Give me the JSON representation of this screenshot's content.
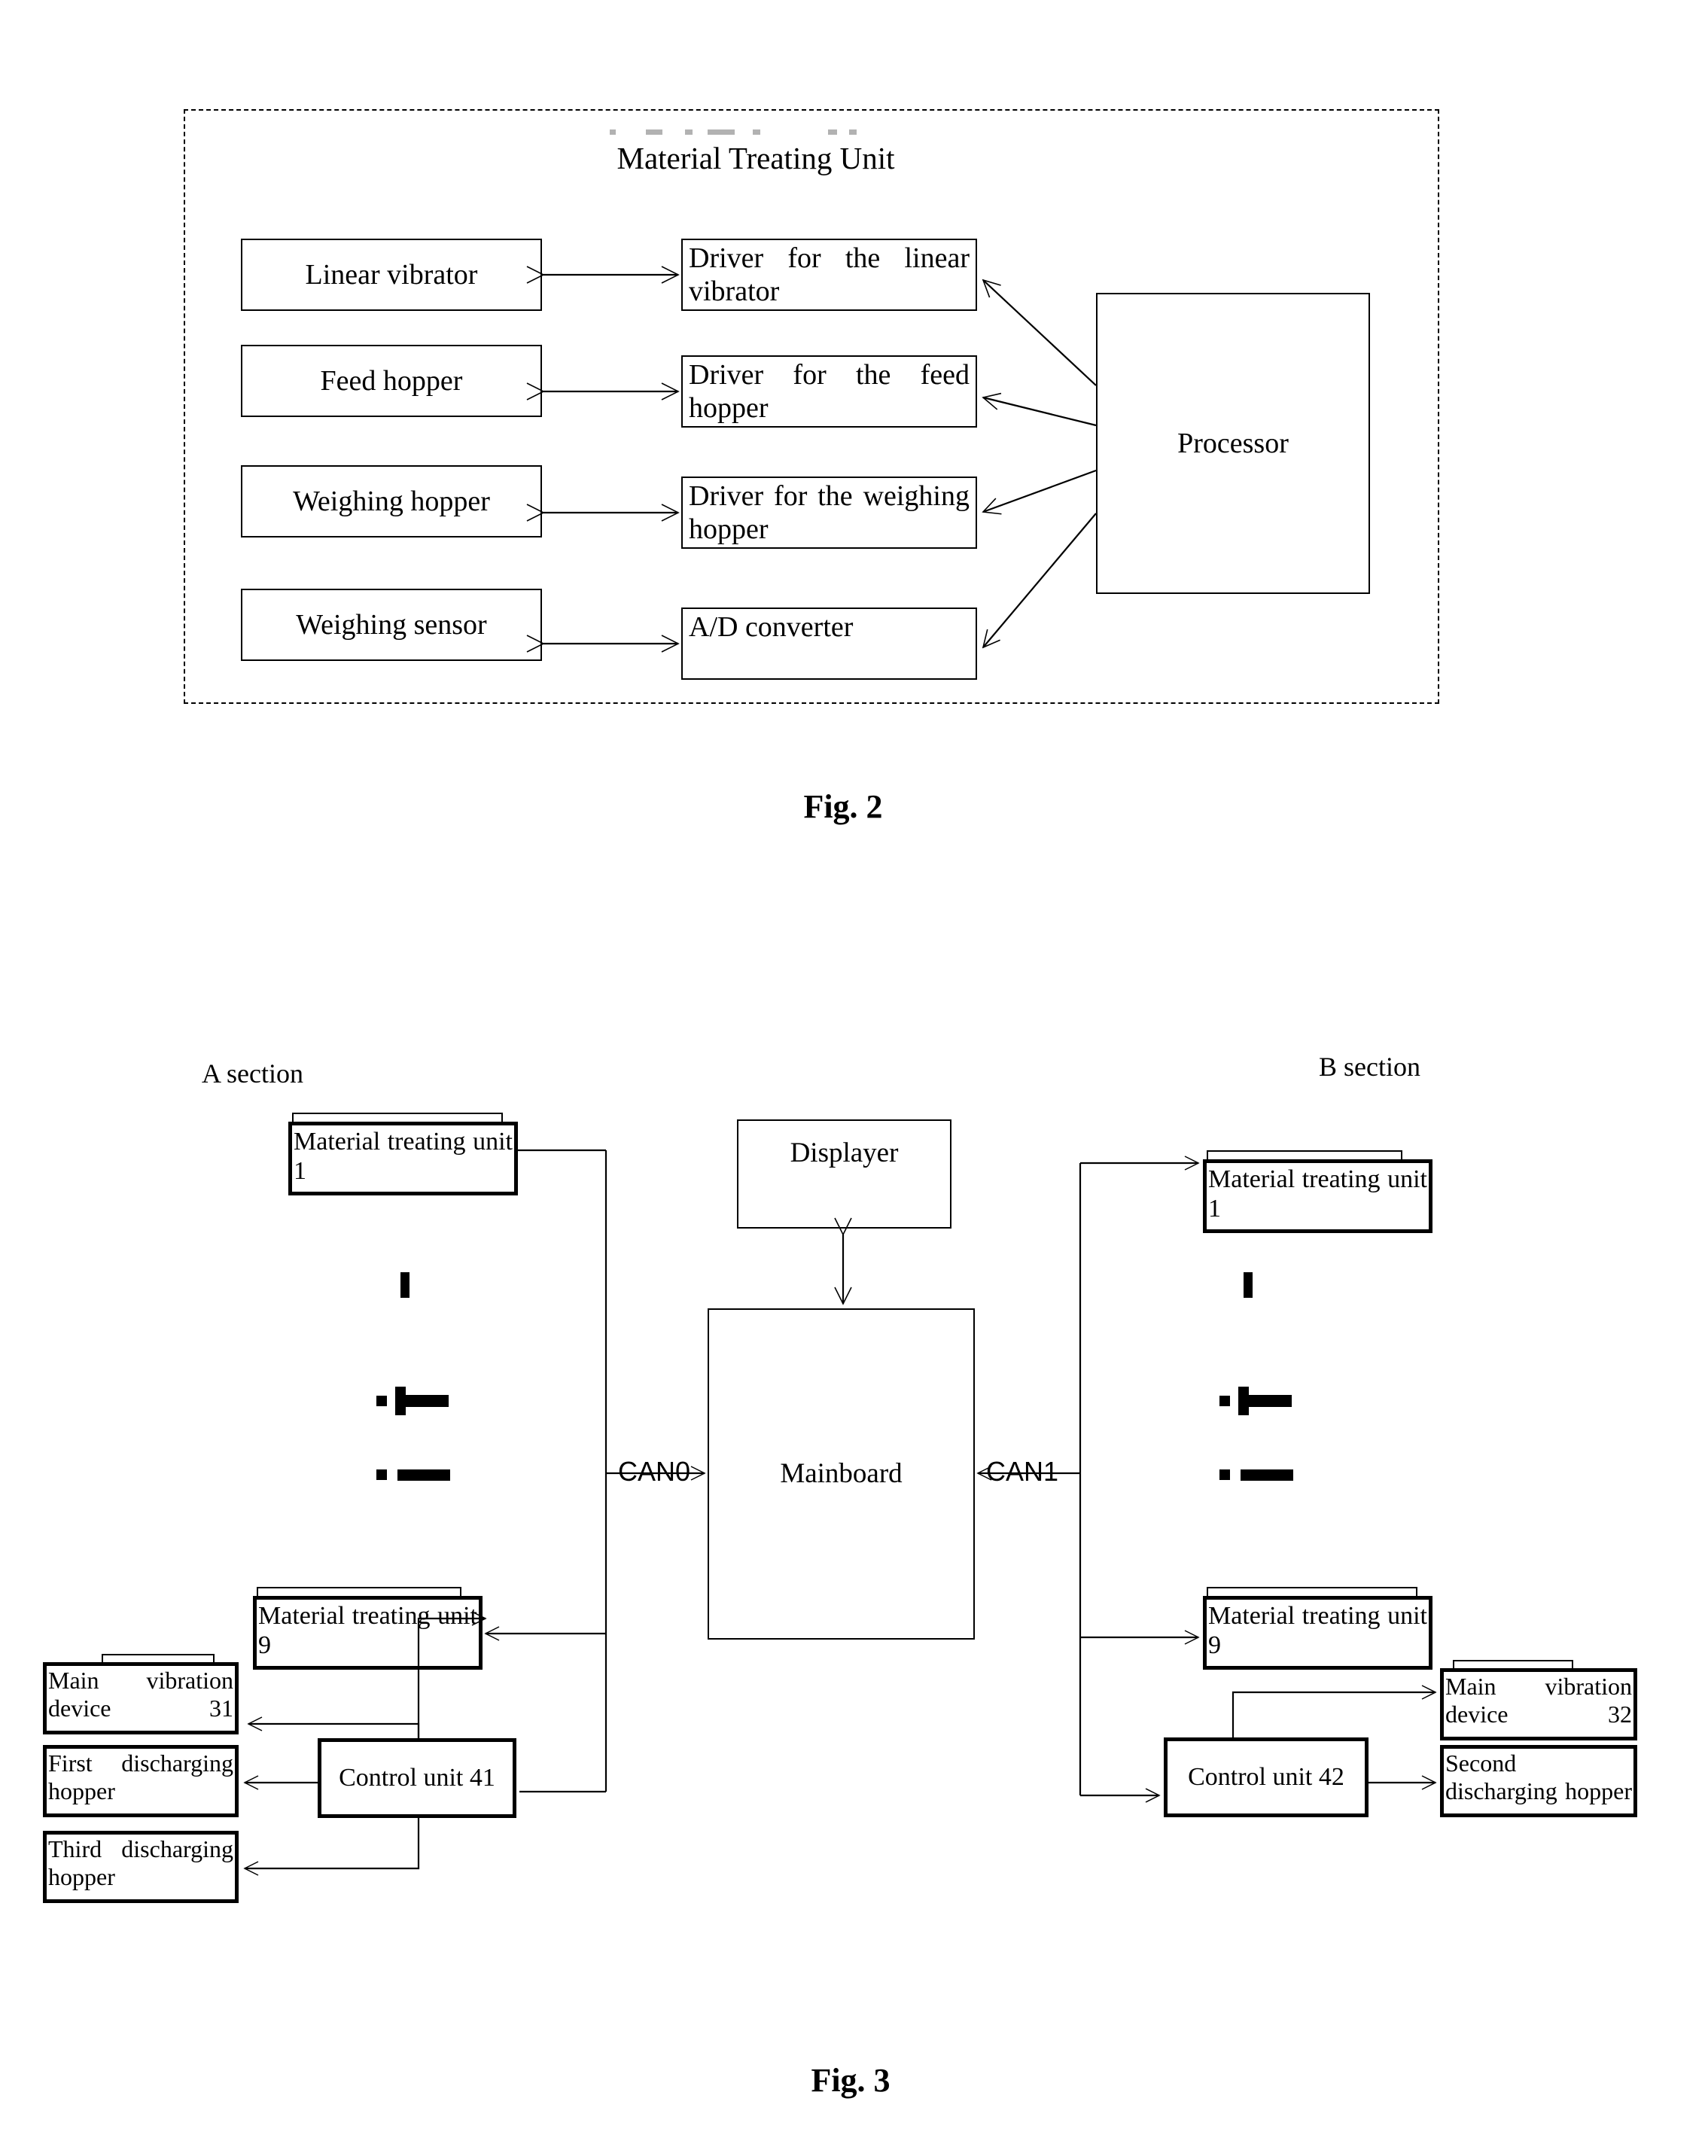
{
  "figure2": {
    "enclosure_label": "Material Treating Unit",
    "caption": "Fig. 2",
    "left_boxes": [
      {
        "label": "Linear vibrator"
      },
      {
        "label": "Feed hopper"
      },
      {
        "label": "Weighing hopper"
      },
      {
        "label": "Weighing sensor"
      }
    ],
    "driver_boxes": [
      {
        "label": "Driver for the linear vibrator"
      },
      {
        "label": "Driver for the feed hopper"
      },
      {
        "label": "Driver for the weighing hopper"
      },
      {
        "label": "A/D converter"
      }
    ],
    "processor": {
      "label": "Processor"
    }
  },
  "figure3": {
    "caption": "Fig. 3",
    "section_a_label": "A section",
    "section_b_label": "B section",
    "bus_a_label": "CAN0",
    "bus_b_label": "CAN1",
    "displayer": {
      "label": "Displayer"
    },
    "mainboard": {
      "label": "Mainboard"
    },
    "section_a": {
      "unit_first": {
        "label": "Material treating unit 1"
      },
      "unit_last": {
        "label": "Material treating unit 9"
      },
      "control_unit": {
        "label": "Control unit 41"
      },
      "peripherals": [
        {
          "label": "Main vibration device 31"
        },
        {
          "label": "First discharging hopper"
        },
        {
          "label": "Third discharging hopper"
        }
      ]
    },
    "section_b": {
      "unit_first": {
        "label": "Material treating unit 1"
      },
      "unit_last": {
        "label": "Material treating unit 9"
      },
      "control_unit": {
        "label": "Control unit 42"
      },
      "peripherals": [
        {
          "label": "Main vibration device 32"
        },
        {
          "label": "Second discharging hopper"
        }
      ]
    }
  },
  "style": {
    "ink": "#000000",
    "paper": "#ffffff"
  }
}
